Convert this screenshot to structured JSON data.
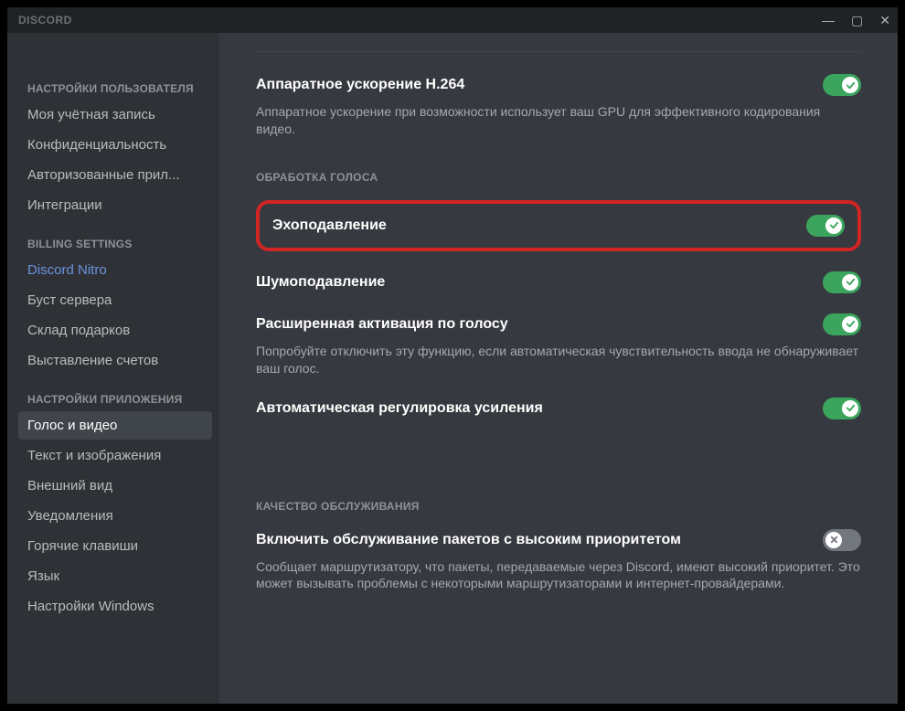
{
  "app": {
    "title": "DISCORD"
  },
  "sidebar": {
    "sections": [
      {
        "header": "НАСТРОЙКИ ПОЛЬЗОВАТЕЛЯ",
        "items": [
          {
            "label": "Моя учётная запись"
          },
          {
            "label": "Конфиденциальность"
          },
          {
            "label": "Авторизованные прил..."
          },
          {
            "label": "Интеграции"
          }
        ]
      },
      {
        "header": "BILLING SETTINGS",
        "items": [
          {
            "label": "Discord Nitro",
            "nitro": true
          },
          {
            "label": "Буст сервера"
          },
          {
            "label": "Склад подарков"
          },
          {
            "label": "Выставление счетов"
          }
        ]
      },
      {
        "header": "НАСТРОЙКИ ПРИЛОЖЕНИЯ",
        "items": [
          {
            "label": "Голос и видео",
            "active": true
          },
          {
            "label": "Текст и изображения"
          },
          {
            "label": "Внешний вид"
          },
          {
            "label": "Уведомления"
          },
          {
            "label": "Горячие клавиши"
          },
          {
            "label": "Язык"
          },
          {
            "label": "Настройки Windows"
          }
        ]
      }
    ]
  },
  "settings": {
    "hw_accel": {
      "title": "Аппаратное ускорение H.264",
      "desc": "Аппаратное ускорение при возможности использует ваш GPU для эффективного кодирования видео.",
      "on": true
    },
    "voice_processing_header": "ОБРАБОТКА ГОЛОСА",
    "echo": {
      "title": "Эхоподавление",
      "on": true
    },
    "noise": {
      "title": "Шумоподавление",
      "on": true
    },
    "advanced_activation": {
      "title": "Расширенная активация по голосу",
      "desc": "Попробуйте отключить эту функцию, если автоматическая чувствительность ввода не обнаруживает ваш голос.",
      "on": true
    },
    "auto_gain": {
      "title": "Автоматическая регулировка усиления",
      "on": true
    },
    "qos_header": "КАЧЕСТВО ОБСЛУЖИВАНИЯ",
    "qos": {
      "title": "Включить обслуживание пакетов с высоким приоритетом",
      "desc": "Сообщает маршрутизатору, что пакеты, передаваемые через Discord, имеют высокий приоритет. Это может вызывать проблемы с некоторыми маршрутизаторами и интернет-провайдерами.",
      "on": false
    }
  },
  "colors": {
    "toggle_on": "#3ba55d",
    "toggle_off": "#72767d",
    "highlight_border": "#d22424"
  }
}
